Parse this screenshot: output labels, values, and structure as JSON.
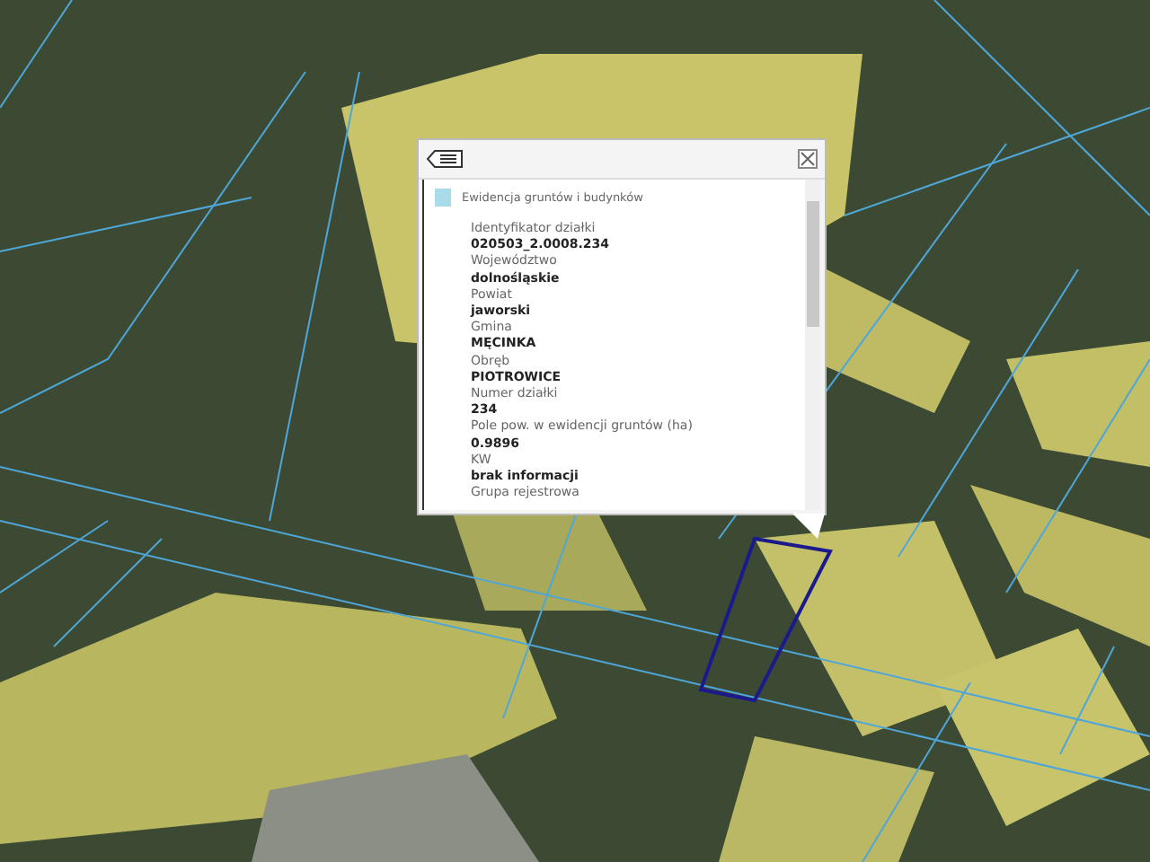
{
  "popup": {
    "title": "Ewidencja gruntów i budynków",
    "fields": [
      {
        "label": "Identyfikator działki",
        "value": "020503_2.0008.234"
      },
      {
        "label": "Województwo",
        "value": "dolnośląskie"
      },
      {
        "label": "Powiat",
        "value": "jaworski"
      },
      {
        "label": "Gmina",
        "value": "MĘCINKA"
      },
      {
        "label": "Obręb",
        "value": "PIOTROWICE"
      },
      {
        "label": "Numer działki",
        "value": "234"
      },
      {
        "label": "Pole pow. w ewidencji gruntów (ha)",
        "value": "0.9896"
      },
      {
        "label": "KW",
        "value": "brak informacji"
      },
      {
        "label": "Grupa rejestrowa"
      }
    ]
  }
}
